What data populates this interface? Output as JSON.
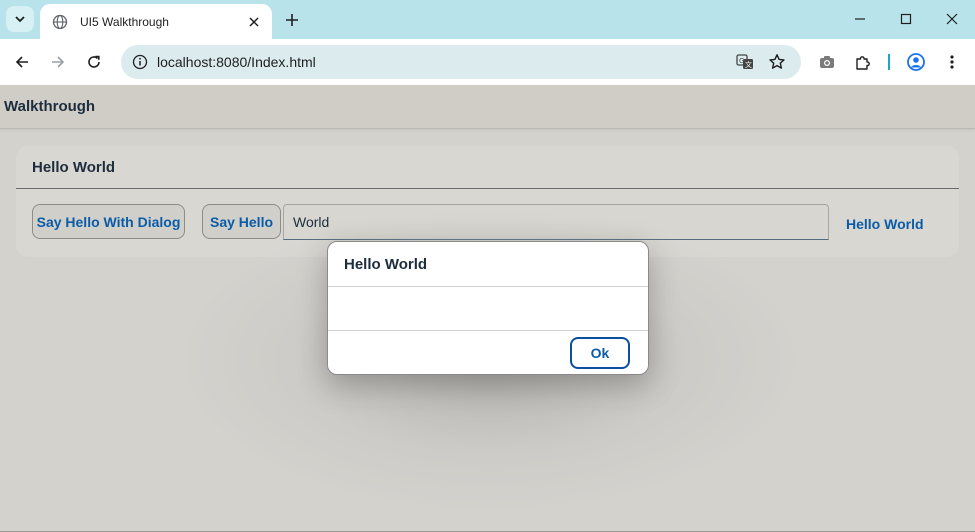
{
  "browser": {
    "tab_title": "UI5 Walkthrough",
    "url": "localhost:8080/Index.html",
    "icons": {
      "tab_search": "chevron-down-icon",
      "favicon": "globe-icon",
      "tab_close": "close-icon",
      "new_tab": "plus-icon",
      "back": "arrow-left-icon",
      "forward": "arrow-right-icon",
      "reload": "reload-icon",
      "site_info": "tune-icon",
      "translate": "translate-icon",
      "bookmark": "star-icon",
      "screenshot": "camera-icon",
      "extensions": "puzzle-icon",
      "profile": "account-icon",
      "menu": "kebab-menu-icon"
    },
    "colors": {
      "titlebar": "#b9e3ea",
      "omnibox": "#dcebee"
    }
  },
  "app": {
    "title": "Walkthrough",
    "panel": {
      "title": "Hello World",
      "dialog_button_label": "Say Hello With Dialog",
      "say_hello_label": "Say Hello",
      "input_value": "World",
      "output_text": "Hello World"
    },
    "dialog": {
      "title": "Hello World",
      "ok_label": "Ok"
    },
    "colors": {
      "accent": "#0a5ca8",
      "text": "#1d2d3e",
      "background": "#d4d2cd"
    }
  }
}
